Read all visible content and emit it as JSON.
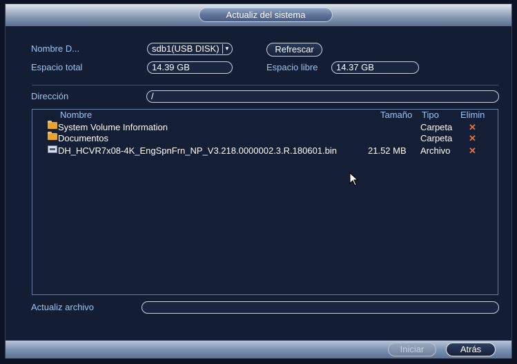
{
  "dialog": {
    "title": "Actualiz del sistema"
  },
  "device": {
    "name_label": "Nombre D...",
    "name_value": "sdb1(USB DISK)",
    "refresh_label": "Refrescar",
    "total_label": "Espacio total",
    "total_value": "14.39 GB",
    "free_label": "Espacio libre",
    "free_value": "14.37 GB"
  },
  "path": {
    "label": "Dirección",
    "value": "/"
  },
  "table": {
    "columns": {
      "name": "Nombre",
      "size": "Tamaño",
      "type": "Tipo",
      "delete": "Elimin"
    },
    "rows": [
      {
        "icon": "folder-icon",
        "name": "System Volume Information",
        "size": "",
        "type": "Carpeta",
        "delete": "✕"
      },
      {
        "icon": "folder-icon",
        "name": "Documentos",
        "size": "",
        "type": "Carpeta",
        "delete": "✕"
      },
      {
        "icon": "file-icon",
        "name": "DH_HCVR7x08-4K_EngSpnFrn_NP_V3.218.0000002.3.R.180601.bin",
        "size": "21.52 MB",
        "type": "Archivo",
        "delete": "✕"
      }
    ]
  },
  "update_file": {
    "label": "Actualiz archivo",
    "value": ""
  },
  "footer": {
    "start_label": "Iniciar",
    "back_label": "Atrás"
  },
  "colors": {
    "accent_text": "#9ec4f2",
    "delete_icon": "#ff6a1e",
    "folder": "#e8a532"
  }
}
